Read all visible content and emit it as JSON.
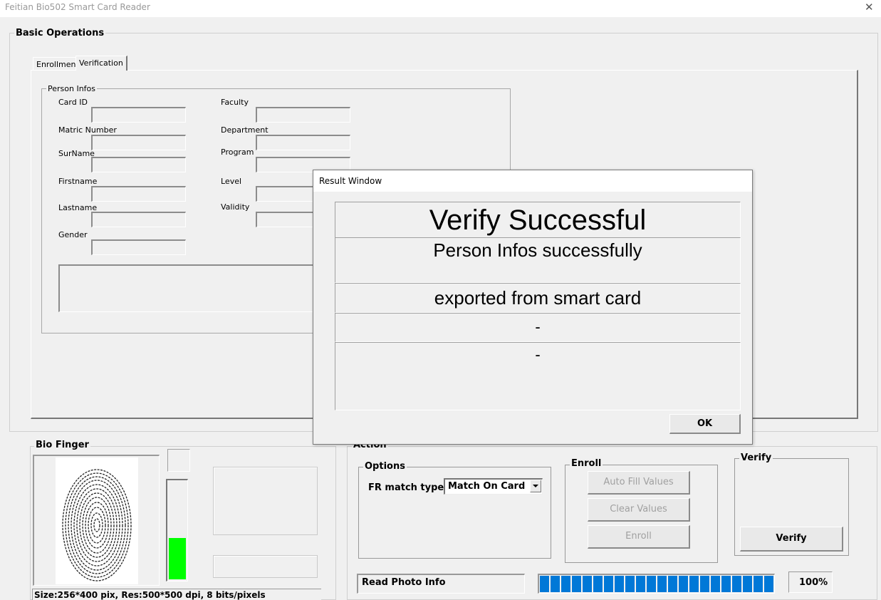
{
  "window": {
    "title": "Feitian Bio502 Smart Card Reader",
    "close_glyph": "✕"
  },
  "basic_ops": {
    "title": "Basic Operations",
    "tabs": [
      {
        "label": "Enrollment"
      },
      {
        "label": "Verification"
      }
    ],
    "person_infos": {
      "title": "Person Infos",
      "labels": {
        "card_id": "Card ID",
        "matric": "Matric Number",
        "surname": "SurName",
        "firstname": "Firstname",
        "lastname": "Lastname",
        "gender": "Gender",
        "faculty": "Faculty",
        "department": "Department",
        "program": "Program",
        "level": "Level",
        "validity": "Validity"
      }
    }
  },
  "bio_finger": {
    "title": "Bio Finger",
    "status_text": "Size:256*400 pix, Res:500*500 dpi, 8 bits/pixels",
    "quality_level": 0.42,
    "quality_color": "#00ff00"
  },
  "action": {
    "title": "Action",
    "options": {
      "title": "Options",
      "match_label": "FR match type",
      "match_value": "Match On Card"
    },
    "enroll": {
      "title": "Enroll",
      "auto_fill": "Auto Fill Values",
      "clear": "Clear Values",
      "enroll": "Enroll"
    },
    "verify": {
      "title": "Verify",
      "button": "Verify"
    },
    "read_status": "Read Photo Info",
    "progress": {
      "percent_text": "100%",
      "value": 1.0,
      "color": "#0078d7"
    }
  },
  "result_dialog": {
    "title": "Result Window",
    "line1": "Verify Successful",
    "line2": "Person Infos successfully",
    "line3": "exported from smart card",
    "line4": "-",
    "line5": "-",
    "ok": "OK"
  }
}
